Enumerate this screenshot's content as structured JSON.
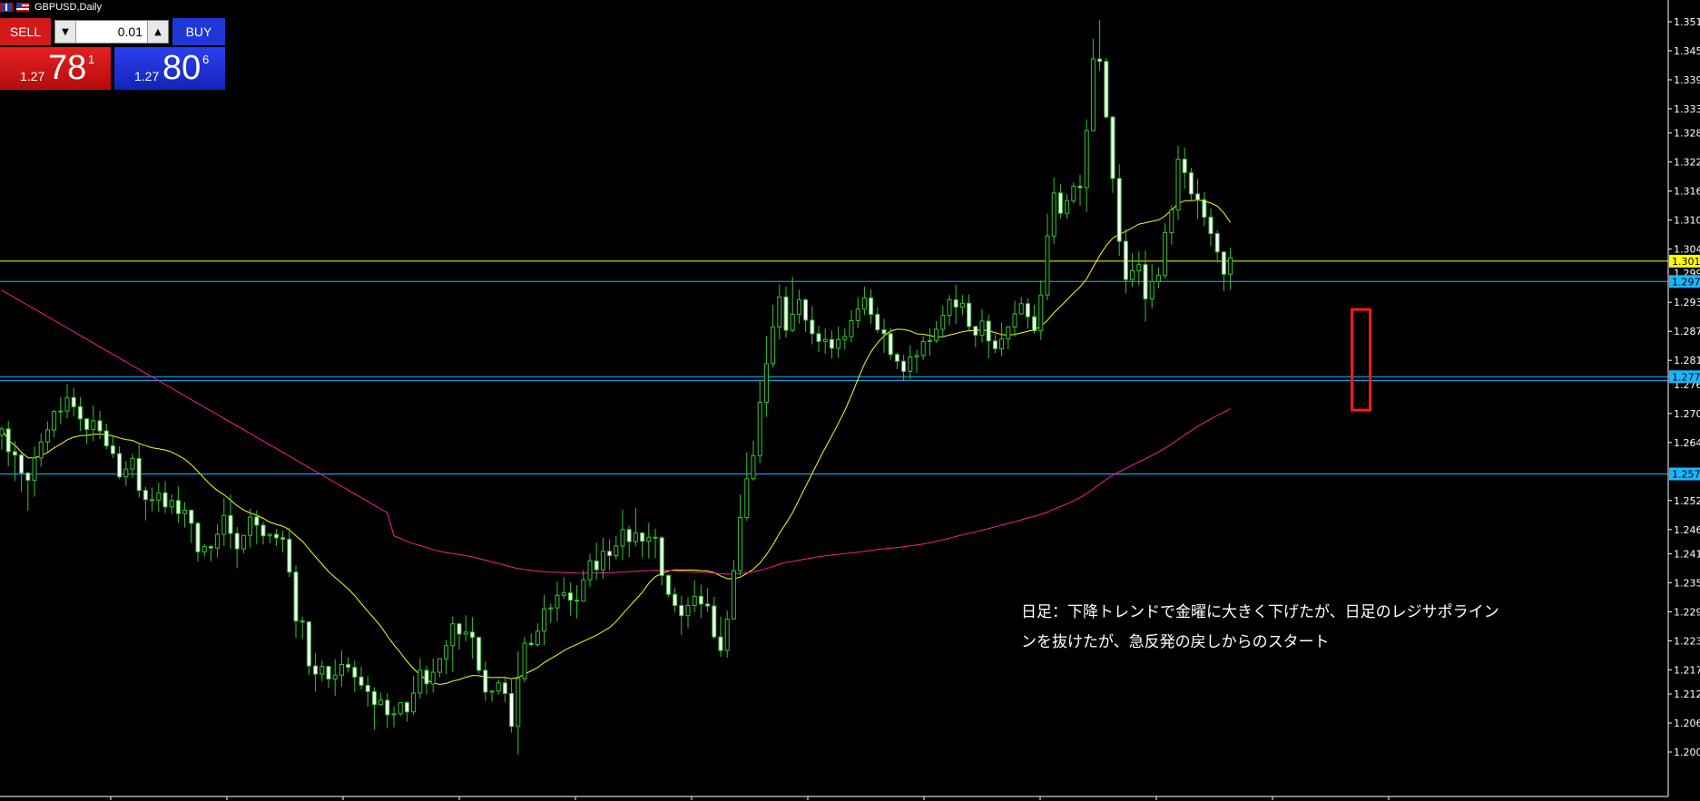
{
  "header": {
    "symbol": "GBPUSD,Daily",
    "flags": [
      "uk-flag-icon",
      "us-flag-icon"
    ]
  },
  "trade_panel": {
    "sell_label": "SELL",
    "buy_label": "BUY",
    "lot": "0.01",
    "sell_price": {
      "prefix": "1.27",
      "big": "78",
      "sup": "1"
    },
    "buy_price": {
      "prefix": "1.27",
      "big": "80",
      "sup": "6"
    },
    "colors": {
      "sell": "#d21a1a",
      "buy": "#1f37d6"
    }
  },
  "annotation": {
    "line1": "日足：下降トレンドで金曜に大きく下げたが、日足のレジサポライン",
    "line2": "ンを抜けたが、急反発の戻しからのスタート"
  },
  "chart_data": {
    "type": "candlestick",
    "title": "GBPUSD,Daily",
    "ylim": [
      1.197,
      1.354
    ],
    "y_ticks": [
      "1.351",
      "1.345",
      "1.339",
      "1.333",
      "1.328",
      "1.322",
      "1.316",
      "1.310",
      "1.304",
      "1.293",
      "1.287",
      "1.281",
      "1.270",
      "1.264",
      "1.252",
      "1.246",
      "1.241",
      "1.235",
      "1.229",
      "1.223",
      "1.217",
      "1.212",
      "1.206",
      "1.200"
    ],
    "horizontal_levels": [
      {
        "price": 1.3015,
        "label": "1.301",
        "color": "#ffff00"
      },
      {
        "price": 1.2973,
        "label": "1.297",
        "color": "#19b7ff"
      },
      {
        "price": 1.2776,
        "label": "1.277",
        "color": "#19b7ff"
      },
      {
        "price": 1.2768,
        "label": "",
        "color": "#19b7ff"
      },
      {
        "price": 1.2575,
        "label": "1.257",
        "color": "#19b7ff"
      }
    ],
    "extra_axis_labels": [
      "1.299",
      "1.276"
    ],
    "highlight": {
      "from_index": 208,
      "to_index": 208,
      "low": 1.2707,
      "high": 1.2915,
      "color": "#ff1a1a"
    },
    "candle_colors": {
      "up": "#33c433",
      "down": "#ffffff"
    },
    "ma_colors": {
      "fast": "#ffff00",
      "slow": "#ff1a9a"
    },
    "candles": [
      [
        1.2655,
        1.2668,
        1.2625,
        1.2673
      ],
      [
        1.2668,
        1.2621,
        1.2591,
        1.2685
      ],
      [
        1.2621,
        1.2614,
        1.256,
        1.2643
      ],
      [
        1.2614,
        1.2577,
        1.2538,
        1.2618
      ],
      [
        1.2577,
        1.2562,
        1.2499,
        1.2579
      ],
      [
        1.2562,
        1.2608,
        1.2528,
        1.2632
      ],
      [
        1.2608,
        1.2641,
        1.259,
        1.2659
      ],
      [
        1.2641,
        1.2666,
        1.2622,
        1.2684
      ],
      [
        1.2666,
        1.2704,
        1.2651,
        1.2708
      ],
      [
        1.2704,
        1.2705,
        1.2679,
        1.2734
      ],
      [
        1.2705,
        1.2733,
        1.269,
        1.2761
      ],
      [
        1.2733,
        1.2714,
        1.2694,
        1.2753
      ],
      [
        1.2714,
        1.2689,
        1.2664,
        1.2734
      ],
      [
        1.2689,
        1.2667,
        1.2637,
        1.2677
      ],
      [
        1.2667,
        1.2685,
        1.2643,
        1.2716
      ],
      [
        1.2685,
        1.2664,
        1.2647,
        1.2705
      ],
      [
        1.2664,
        1.2633,
        1.2626,
        1.2679
      ],
      [
        1.2633,
        1.2617,
        1.2608,
        1.2655
      ],
      [
        1.2617,
        1.2569,
        1.2564,
        1.2632
      ],
      [
        1.2569,
        1.2585,
        1.255,
        1.2602
      ],
      [
        1.2585,
        1.2607,
        1.2567,
        1.2617
      ],
      [
        1.2607,
        1.2541,
        1.2526,
        1.2637
      ],
      [
        1.2541,
        1.2522,
        1.2479,
        1.2548
      ],
      [
        1.2522,
        1.2521,
        1.2498,
        1.2547
      ],
      [
        1.2521,
        1.2536,
        1.2496,
        1.2557
      ],
      [
        1.2536,
        1.2507,
        1.2494,
        1.256
      ],
      [
        1.2507,
        1.252,
        1.2492,
        1.2533
      ],
      [
        1.252,
        1.2493,
        1.2474,
        1.2549
      ],
      [
        1.2493,
        1.25,
        1.2464,
        1.2517
      ],
      [
        1.25,
        1.2473,
        1.2432,
        1.2497
      ],
      [
        1.2473,
        1.2414,
        1.2394,
        1.2476
      ],
      [
        1.2414,
        1.2425,
        1.2404,
        1.243
      ],
      [
        1.2425,
        1.2422,
        1.2394,
        1.2429
      ],
      [
        1.2422,
        1.245,
        1.2402,
        1.2472
      ],
      [
        1.245,
        1.2489,
        1.2426,
        1.2525
      ],
      [
        1.2489,
        1.2452,
        1.242,
        1.2533
      ],
      [
        1.2452,
        1.242,
        1.238,
        1.2465
      ],
      [
        1.242,
        1.2448,
        1.2411,
        1.2448
      ],
      [
        1.2448,
        1.2486,
        1.2423,
        1.2503
      ],
      [
        1.2486,
        1.2469,
        1.243,
        1.25
      ],
      [
        1.2469,
        1.2447,
        1.2429,
        1.2476
      ],
      [
        1.2447,
        1.245,
        1.2432,
        1.2453
      ],
      [
        1.245,
        1.2443,
        1.2426,
        1.2461
      ],
      [
        1.2443,
        1.244,
        1.2413,
        1.2458
      ],
      [
        1.244,
        1.2372,
        1.2362,
        1.2464
      ],
      [
        1.2372,
        1.2271,
        1.2236,
        1.2386
      ],
      [
        1.2271,
        1.2269,
        1.2234,
        1.228
      ],
      [
        1.2269,
        1.2178,
        1.2159,
        1.2269
      ],
      [
        1.2178,
        1.2161,
        1.2125,
        1.2205
      ],
      [
        1.2161,
        1.2177,
        1.2146,
        1.2189
      ],
      [
        1.2177,
        1.2151,
        1.2133,
        1.2177
      ],
      [
        1.2151,
        1.2159,
        1.2116,
        1.2192
      ],
      [
        1.2159,
        1.2181,
        1.2135,
        1.221
      ],
      [
        1.2181,
        1.2175,
        1.2164,
        1.2196
      ],
      [
        1.2175,
        1.2155,
        1.2124,
        1.2189
      ],
      [
        1.2155,
        1.2138,
        1.2129,
        1.2176
      ],
      [
        1.2138,
        1.2125,
        1.2094,
        1.2157
      ],
      [
        1.2125,
        1.2098,
        1.2046,
        1.2134
      ],
      [
        1.2098,
        1.2107,
        1.2096,
        1.2123
      ],
      [
        1.2107,
        1.2077,
        1.2049,
        1.2121
      ],
      [
        1.2077,
        1.2079,
        1.2051,
        1.2094
      ],
      [
        1.2079,
        1.2102,
        1.2074,
        1.2102
      ],
      [
        1.2102,
        1.2083,
        1.2063,
        1.2105
      ],
      [
        1.2083,
        1.2122,
        1.2077,
        1.2158
      ],
      [
        1.2122,
        1.2169,
        1.2111,
        1.2194
      ],
      [
        1.2169,
        1.2141,
        1.2119,
        1.2179
      ],
      [
        1.2141,
        1.2165,
        1.2123,
        1.2193
      ],
      [
        1.2165,
        1.2193,
        1.2155,
        1.2192
      ],
      [
        1.2193,
        1.222,
        1.2161,
        1.2232
      ],
      [
        1.222,
        1.2265,
        1.2166,
        1.228
      ],
      [
        1.2265,
        1.2244,
        1.2212,
        1.2267
      ],
      [
        1.2244,
        1.2248,
        1.2229,
        1.2283
      ],
      [
        1.2248,
        1.2237,
        1.2193,
        1.2279
      ],
      [
        1.2237,
        1.2169,
        1.2163,
        1.2239
      ],
      [
        1.2169,
        1.2124,
        1.2106,
        1.2187
      ],
      [
        1.2124,
        1.2126,
        1.2104,
        1.2127
      ],
      [
        1.2126,
        1.2143,
        1.2119,
        1.215
      ],
      [
        1.2143,
        1.2121,
        1.2103,
        1.2156
      ],
      [
        1.2121,
        1.2053,
        1.204,
        1.2153
      ],
      [
        1.2053,
        1.2152,
        1.1995,
        1.2208
      ],
      [
        1.2152,
        1.2225,
        1.2144,
        1.2238
      ],
      [
        1.2225,
        1.2222,
        1.2219,
        1.2245
      ],
      [
        1.2222,
        1.225,
        1.2217,
        1.2266
      ],
      [
        1.225,
        1.2296,
        1.2221,
        1.2325
      ],
      [
        1.2296,
        1.2298,
        1.2267,
        1.2307
      ],
      [
        1.2298,
        1.2324,
        1.2271,
        1.2353
      ],
      [
        1.2324,
        1.2329,
        1.2317,
        1.2361
      ],
      [
        1.2329,
        1.2314,
        1.2282,
        1.2351
      ],
      [
        1.2314,
        1.2312,
        1.2276,
        1.2345
      ],
      [
        1.2312,
        1.2356,
        1.2311,
        1.2376
      ],
      [
        1.2356,
        1.2395,
        1.2341,
        1.241
      ],
      [
        1.2395,
        1.2377,
        1.2356,
        1.2433
      ],
      [
        1.2377,
        1.2415,
        1.2358,
        1.2443
      ],
      [
        1.2415,
        1.2406,
        1.2376,
        1.244
      ],
      [
        1.2406,
        1.2426,
        1.2398,
        1.2447
      ],
      [
        1.2426,
        1.246,
        1.2397,
        1.2501
      ],
      [
        1.246,
        1.2435,
        1.2403,
        1.2468
      ],
      [
        1.2435,
        1.2453,
        1.2425,
        1.2505
      ],
      [
        1.2453,
        1.2436,
        1.2402,
        1.2446
      ],
      [
        1.2436,
        1.2444,
        1.24,
        1.2474
      ],
      [
        1.2444,
        1.2443,
        1.2401,
        1.2462
      ],
      [
        1.2443,
        1.2365,
        1.2345,
        1.2447
      ],
      [
        1.2365,
        1.2326,
        1.232,
        1.2368
      ],
      [
        1.2326,
        1.2303,
        1.2289,
        1.234
      ],
      [
        1.2303,
        1.2282,
        1.2242,
        1.2323
      ],
      [
        1.2282,
        1.2303,
        1.2257,
        1.232
      ],
      [
        1.2303,
        1.2322,
        1.2289,
        1.2355
      ],
      [
        1.2322,
        1.2306,
        1.2278,
        1.2346
      ],
      [
        1.2306,
        1.2302,
        1.229,
        1.2339
      ],
      [
        1.2302,
        1.2238,
        1.2234,
        1.2321
      ],
      [
        1.2238,
        1.221,
        1.2197,
        1.228
      ],
      [
        1.221,
        1.2275,
        1.2195,
        1.2293
      ],
      [
        1.2275,
        1.2375,
        1.2274,
        1.2397
      ],
      [
        1.2375,
        1.2485,
        1.2365,
        1.2533
      ],
      [
        1.2485,
        1.2565,
        1.2478,
        1.262
      ],
      [
        1.2565,
        1.2613,
        1.2561,
        1.2644
      ],
      [
        1.2613,
        1.2723,
        1.2598,
        1.2768
      ],
      [
        1.2723,
        1.2803,
        1.2693,
        1.286
      ],
      [
        1.2803,
        1.2879,
        1.2795,
        1.2925
      ],
      [
        1.2879,
        1.2941,
        1.2853,
        1.2967
      ],
      [
        1.2941,
        1.2872,
        1.2857,
        1.2962
      ],
      [
        1.2872,
        1.2905,
        1.2868,
        1.2983
      ],
      [
        1.2905,
        1.2935,
        1.2886,
        1.2956
      ],
      [
        1.2935,
        1.2893,
        1.2869,
        1.2938
      ],
      [
        1.2893,
        1.2865,
        1.2843,
        1.2922
      ],
      [
        1.2865,
        1.2849,
        1.2827,
        1.2881
      ],
      [
        1.2849,
        1.2853,
        1.2823,
        1.2876
      ],
      [
        1.2853,
        1.2835,
        1.2813,
        1.2872
      ],
      [
        1.2835,
        1.2853,
        1.2815,
        1.288
      ],
      [
        1.2853,
        1.2859,
        1.2832,
        1.2876
      ],
      [
        1.2859,
        1.2892,
        1.2847,
        1.2914
      ],
      [
        1.2892,
        1.2916,
        1.2876,
        1.2941
      ],
      [
        1.2916,
        1.2939,
        1.2904,
        1.2962
      ],
      [
        1.2939,
        1.2905,
        1.2885,
        1.2957
      ],
      [
        1.2905,
        1.2873,
        1.2866,
        1.292
      ],
      [
        1.2873,
        1.2865,
        1.2825,
        1.2896
      ],
      [
        1.2865,
        1.2822,
        1.2811,
        1.2877
      ],
      [
        1.2822,
        1.2808,
        1.2792,
        1.2826
      ],
      [
        1.2808,
        1.2787,
        1.2768,
        1.2821
      ],
      [
        1.2787,
        1.2817,
        1.277,
        1.2841
      ],
      [
        1.2817,
        1.282,
        1.2784,
        1.2832
      ],
      [
        1.282,
        1.2849,
        1.2811,
        1.286
      ],
      [
        1.2849,
        1.2851,
        1.282,
        1.2877
      ],
      [
        1.2851,
        1.2874,
        1.2846,
        1.2891
      ],
      [
        1.2874,
        1.2903,
        1.286,
        1.2923
      ],
      [
        1.2903,
        1.2935,
        1.2883,
        1.2945
      ],
      [
        1.2935,
        1.292,
        1.2885,
        1.2966
      ],
      [
        1.292,
        1.2928,
        1.2903,
        1.2945
      ],
      [
        1.2928,
        1.288,
        1.2869,
        1.2946
      ],
      [
        1.288,
        1.2862,
        1.2837,
        1.2874
      ],
      [
        1.2862,
        1.2891,
        1.2847,
        1.2916
      ],
      [
        1.2891,
        1.285,
        1.2814,
        1.2904
      ],
      [
        1.285,
        1.2834,
        1.2825,
        1.2864
      ],
      [
        1.2834,
        1.2854,
        1.2818,
        1.2888
      ],
      [
        1.2854,
        1.2879,
        1.2833,
        1.2881
      ],
      [
        1.2879,
        1.2906,
        1.2859,
        1.2933
      ],
      [
        1.2906,
        1.2927,
        1.2904,
        1.2941
      ],
      [
        1.2927,
        1.29,
        1.2875,
        1.2938
      ],
      [
        1.29,
        1.2871,
        1.2865,
        1.2925
      ],
      [
        1.2871,
        1.2945,
        1.2852,
        1.2975
      ],
      [
        1.2945,
        1.3067,
        1.2934,
        1.3113
      ],
      [
        1.3067,
        1.3156,
        1.3051,
        1.3188
      ],
      [
        1.3156,
        1.3114,
        1.3104,
        1.3174
      ],
      [
        1.3114,
        1.314,
        1.3102,
        1.3153
      ],
      [
        1.314,
        1.317,
        1.3134,
        1.3178
      ],
      [
        1.317,
        1.3167,
        1.3129,
        1.3194
      ],
      [
        1.3167,
        1.3285,
        1.3117,
        1.3308
      ],
      [
        1.3285,
        1.3433,
        1.3283,
        1.3475
      ],
      [
        1.3433,
        1.3428,
        1.3409,
        1.3513
      ],
      [
        1.3428,
        1.3313,
        1.331,
        1.3435
      ],
      [
        1.3313,
        1.3186,
        1.3156,
        1.3315
      ],
      [
        1.3186,
        1.3056,
        1.3026,
        1.3215
      ],
      [
        1.3056,
        1.2977,
        1.2948,
        1.3082
      ],
      [
        1.2977,
        1.2995,
        1.2962,
        1.3031
      ],
      [
        1.2995,
        1.3008,
        1.2965,
        1.3035
      ],
      [
        1.3008,
        1.2937,
        1.289,
        1.3037
      ],
      [
        1.2937,
        1.2973,
        1.2917,
        1.3009
      ],
      [
        1.2973,
        1.2986,
        1.2959,
        1.3002
      ],
      [
        1.2986,
        1.3074,
        1.2979,
        1.3094
      ],
      [
        1.3074,
        1.3121,
        1.3049,
        1.3131
      ],
      [
        1.3121,
        1.3226,
        1.3101,
        1.3253
      ],
      [
        1.3226,
        1.3198,
        1.3165,
        1.325
      ],
      [
        1.3198,
        1.3154,
        1.3141,
        1.3208
      ],
      [
        1.3154,
        1.3142,
        1.3103,
        1.3185
      ],
      [
        1.3142,
        1.3106,
        1.3087,
        1.3158
      ],
      [
        1.3106,
        1.3072,
        1.3046,
        1.3124
      ],
      [
        1.3072,
        1.3034,
        1.3012,
        1.3079
      ],
      [
        1.3034,
        1.2988,
        1.2953,
        1.3035
      ],
      [
        1.2988,
        1.3022,
        1.2956,
        1.3043
      ]
    ],
    "ma_fast": [
      1.2656,
      1.2652,
      1.2648,
      1.264,
      1.2631,
      1.2621,
      1.2611,
      1.26,
      1.2589,
      1.2578,
      1.2566,
      1.2555,
      1.2545,
      1.2535,
      1.2526,
      1.2516,
      1.2504,
      1.2492,
      1.2478,
      1.2462,
      1.2444,
      1.2425,
      1.2404,
      1.2383,
      1.2363,
      1.2342,
      1.2321,
      1.2301,
      1.2281,
      1.2261,
      1.2241,
      1.222,
      1.2199,
      1.218,
      1.2163,
      1.215,
      1.2142,
      1.214,
      1.2142,
      1.2148,
      1.2158,
      1.217,
      1.2183,
      1.2197,
      1.2211,
      1.2226,
      1.2241,
      1.2257,
      1.2272,
      1.2288,
      1.2301,
      1.2313,
      1.2323,
      1.2332,
      1.234,
      1.2348,
      1.2353,
      1.2356,
      1.2356,
      1.2352,
      1.2352,
      1.2372,
      1.2406,
      1.245,
      1.25,
      1.2553,
      1.2606,
      1.2658,
      1.2707,
      1.2754,
      1.2797,
      1.2834,
      1.286,
      1.287,
      1.287,
      1.2868,
      1.2871,
      1.2876,
      1.288,
      1.2882,
      1.2884,
      1.2885,
      1.2886,
      1.2888,
      1.2892,
      1.2898,
      1.2906,
      1.2919,
      1.2937,
      1.2962,
      1.2987,
      1.3009,
      1.3033,
      1.3058,
      1.308,
      1.3097,
      1.3109,
      1.3117,
      1.3121,
      1.3121,
      1.3119,
      1.3114,
      1.3106,
      1.3095,
      1.3086,
      1.3081,
      1.308,
      1.308,
      1.3078,
      1.3075,
      1.307,
      1.3063,
      1.3058,
      1.3055,
      1.3051,
      1.3044,
      1.3034,
      1.3024,
      1.3014,
      1.3005,
      1.2995,
      1.2981,
      1.2965,
      1.2948
    ]
  }
}
